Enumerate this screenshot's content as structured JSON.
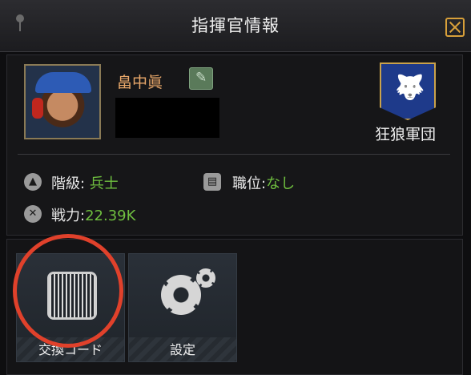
{
  "window": {
    "title": "指揮官情報"
  },
  "commander": {
    "name": "畠中眞",
    "guild_name": "狂狼軍団",
    "rank_label": "階級:",
    "rank_value": "兵士",
    "position_label": "職位:",
    "position_value": "なし",
    "power_label": "戦力:",
    "power_value": "22.39K"
  },
  "tiles": [
    {
      "label": "交換コード",
      "icon": "barcode-icon"
    },
    {
      "label": "設定",
      "icon": "gear-icon"
    }
  ],
  "colors": {
    "accent_gold": "#d8a03a",
    "name_orange": "#e9a86a",
    "value_green": "#6fbf3f",
    "highlight_red": "#e0412b",
    "emblem_blue": "#1e3a8a"
  }
}
